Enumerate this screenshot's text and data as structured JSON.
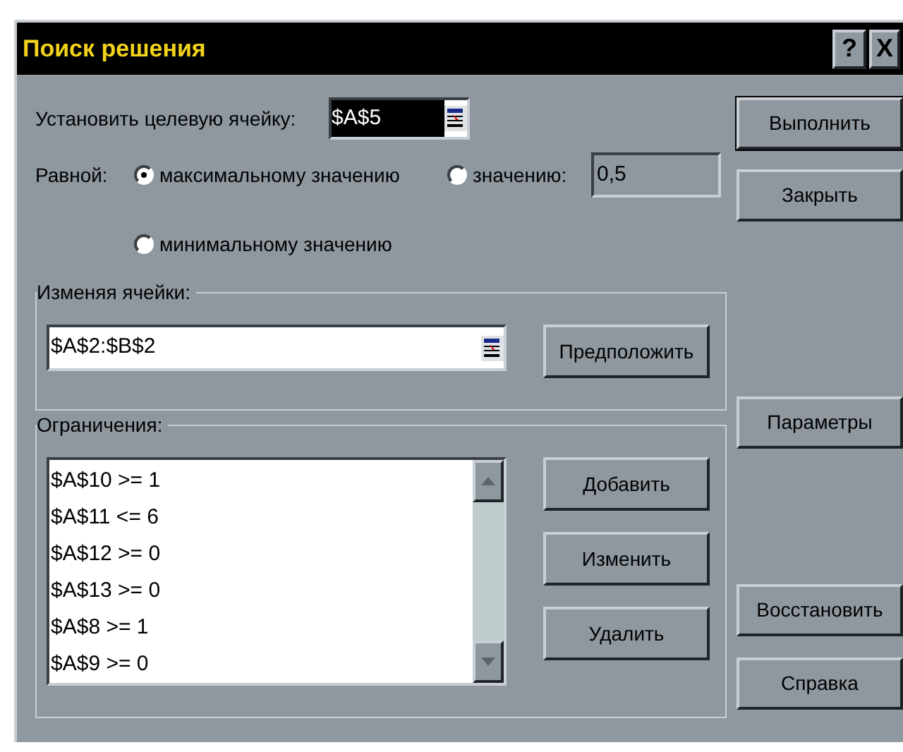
{
  "window": {
    "title": "Поиск решения",
    "help_button": "?",
    "close_button": "X"
  },
  "target": {
    "label": "Установить целевую ячейку:",
    "value": "$A$5"
  },
  "equal_to": {
    "label": "Равной:",
    "options": [
      {
        "text": "максимальному значению",
        "selected": true
      },
      {
        "text": "значению:",
        "selected": false
      },
      {
        "text": "минимальному значению",
        "selected": false
      }
    ],
    "value": "0,5"
  },
  "changing_cells": {
    "label": "Изменяя ячейки:",
    "value": "$A$2:$B$2",
    "button": "Предположить"
  },
  "constraints": {
    "label": "Ограничения:",
    "items": [
      "$A$10 >= 1",
      "$A$11 <= 6",
      "$A$12 >= 0",
      "$A$13 >= 0",
      "$A$8 >= 1",
      "$A$9 >= 0"
    ],
    "buttons": [
      "Добавить",
      "Изменить",
      "Удалить"
    ]
  },
  "side_buttons": [
    {
      "text": "Выполнить",
      "default": true
    },
    {
      "text": "Закрыть",
      "default": false
    },
    {
      "text": "Параметры",
      "default": false
    },
    {
      "text": "Восстановить",
      "default": false
    },
    {
      "text": "Справка",
      "default": false
    }
  ]
}
